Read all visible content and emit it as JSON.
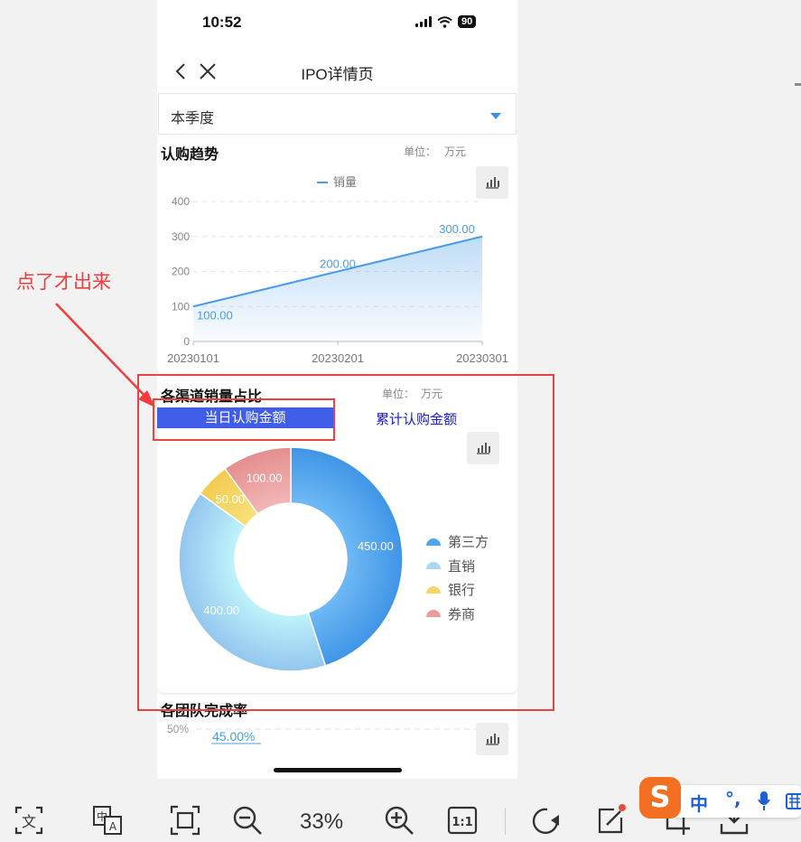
{
  "status": {
    "time": "10:52",
    "battery": "90"
  },
  "nav": {
    "title": "IPO详情页"
  },
  "filter": {
    "selected": "本季度"
  },
  "trend": {
    "title": "认购趋势",
    "unit_label": "单位：",
    "unit": "万元",
    "chart_data": {
      "type": "area",
      "x": [
        "20230101",
        "20230201",
        "20230301"
      ],
      "series": [
        {
          "name": "销量",
          "values": [
            100.0,
            200.0,
            300.0
          ],
          "labels": [
            "100.00",
            "200.00",
            "300.00"
          ]
        }
      ],
      "yticks": [
        "0",
        "100",
        "200",
        "300",
        "400"
      ],
      "ylim": [
        0,
        400
      ],
      "legend": "top-center",
      "grid": "dashed horizontal",
      "color": "#4a9ce8"
    }
  },
  "channels": {
    "title": "各渠道销量占比",
    "unit_label": "单位：",
    "unit": "万元",
    "tabs": {
      "active": "当日认购金额",
      "inactive": "累计认购金额"
    },
    "chart_data": {
      "type": "pie",
      "style": "donut",
      "categories": [
        "第三方",
        "直销",
        "银行",
        "券商"
      ],
      "values": [
        450.0,
        400.0,
        50.0,
        100.0
      ],
      "labels": [
        "450.00",
        "400.00",
        "50.00",
        "100.00"
      ],
      "colors": [
        "#4ea5ef",
        "#a9d6f5",
        "#f5d668",
        "#ee9b9b"
      ],
      "legend": "right"
    }
  },
  "team": {
    "title": "各团队完成率",
    "ytick": "50%",
    "value_label": "45.00%"
  },
  "annotation": {
    "text": "点了才出来"
  },
  "toolbar": {
    "zoom": "33%"
  },
  "ime": {
    "logo": "S",
    "mode": "中",
    "punct": "°,"
  }
}
